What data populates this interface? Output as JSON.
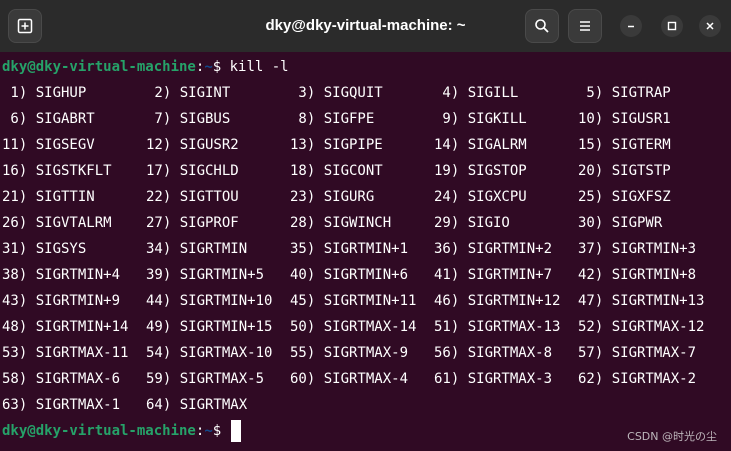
{
  "window": {
    "title": "dky@dky-virtual-machine: ~",
    "buttons": {
      "new_tab": "new-tab-icon",
      "search": "search-icon",
      "menu": "hamburger-menu-icon",
      "minimize": "minimize-icon",
      "maximize": "maximize-icon",
      "close": "close-icon"
    }
  },
  "terminal": {
    "prompt_user_host": "dky@dky-virtual-machine",
    "prompt_colon": ":",
    "prompt_path": "~",
    "prompt_symbol": "$ ",
    "command": "kill -l",
    "colors": {
      "background": "#300a24",
      "user": "#26a269",
      "path": "#12488b",
      "text": "#ffffff"
    },
    "signals": [
      " 1) SIGHUP",
      " 2) SIGINT",
      " 3) SIGQUIT",
      " 4) SIGILL",
      " 5) SIGTRAP",
      " 6) SIGABRT",
      " 7) SIGBUS",
      " 8) SIGFPE",
      " 9) SIGKILL",
      "10) SIGUSR1",
      "11) SIGSEGV",
      "12) SIGUSR2",
      "13) SIGPIPE",
      "14) SIGALRM",
      "15) SIGTERM",
      "16) SIGSTKFLT",
      "17) SIGCHLD",
      "18) SIGCONT",
      "19) SIGSTOP",
      "20) SIGTSTP",
      "21) SIGTTIN",
      "22) SIGTTOU",
      "23) SIGURG",
      "24) SIGXCPU",
      "25) SIGXFSZ",
      "26) SIGVTALRM",
      "27) SIGPROF",
      "28) SIGWINCH",
      "29) SIGIO",
      "30) SIGPWR",
      "31) SIGSYS",
      "34) SIGRTMIN",
      "35) SIGRTMIN+1",
      "36) SIGRTMIN+2",
      "37) SIGRTMIN+3",
      "38) SIGRTMIN+4",
      "39) SIGRTMIN+5",
      "40) SIGRTMIN+6",
      "41) SIGRTMIN+7",
      "42) SIGRTMIN+8",
      "43) SIGRTMIN+9",
      "44) SIGRTMIN+10",
      "45) SIGRTMIN+11",
      "46) SIGRTMIN+12",
      "47) SIGRTMIN+13",
      "48) SIGRTMIN+14",
      "49) SIGRTMIN+15",
      "50) SIGRTMAX-14",
      "51) SIGRTMAX-13",
      "52) SIGRTMAX-12",
      "53) SIGRTMAX-11",
      "54) SIGRTMAX-10",
      "55) SIGRTMAX-9",
      "56) SIGRTMAX-8",
      "57) SIGRTMAX-7",
      "58) SIGRTMAX-6",
      "59) SIGRTMAX-5",
      "60) SIGRTMAX-4",
      "61) SIGRTMAX-3",
      "62) SIGRTMAX-2",
      "63) SIGRTMAX-1",
      "64) SIGRTMAX"
    ]
  },
  "watermark": "CSDN @时光の尘"
}
